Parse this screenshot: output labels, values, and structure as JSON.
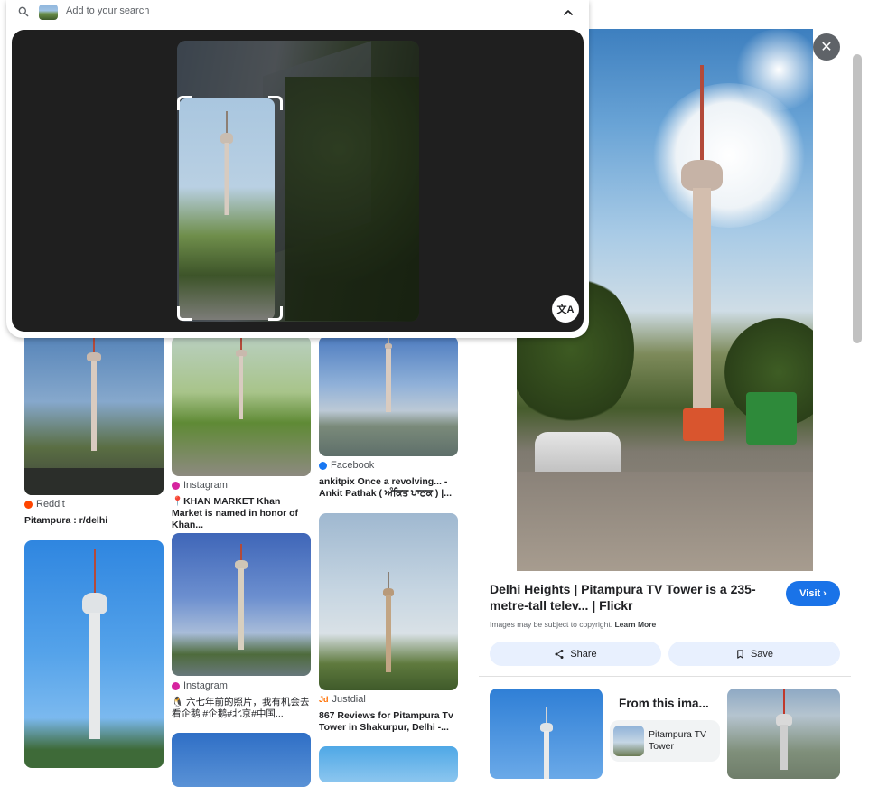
{
  "search": {
    "placeholder": "Add to your search",
    "search_icon": "search-icon",
    "collapse_icon": "chevron-up-icon",
    "translate_label": "文A"
  },
  "results": [
    {
      "source": "Reddit",
      "source_color": "#ff4500",
      "title": "Pitampura : r/delhi"
    },
    {
      "source": "Instagram",
      "source_color": "#d6249f",
      "title": "📍KHAN MARKET Khan Market is named in honor of Khan..."
    },
    {
      "source": "Facebook",
      "source_color": "#1877f2",
      "title": "ankitpix Once a revolving... - Ankit Pathak ( ਅੰਕਿਤ ਪਾਠਕ ) |..."
    },
    {
      "source": "Instagram",
      "source_color": "#d6249f",
      "title": "🐧 六七年前的照片，我有机会去看企鹅 #企鹅#北京#中国..."
    },
    {
      "source": "Justdial",
      "source_color": "#ff6f00",
      "source_badge": "Jd",
      "title": "867 Reviews for Pitampura Tv Tower in Shakurpur, Delhi -..."
    }
  ],
  "detail": {
    "close_label": "✕",
    "title": "Delhi Heights | Pitampura TV Tower is a 235-metre-tall telev... | Flickr",
    "visit_label": "Visit",
    "copyright_text": "Images may be subject to copyright.",
    "learn_more": "Learn More",
    "share_label": "Share",
    "save_label": "Save",
    "from_image_title": "From this ima...",
    "entity_label": "Pitampura TV Tower"
  },
  "colors": {
    "accent": "#1a73e8",
    "pill_bg": "#e8f0fe",
    "panel_dark": "#1f1f1f"
  }
}
